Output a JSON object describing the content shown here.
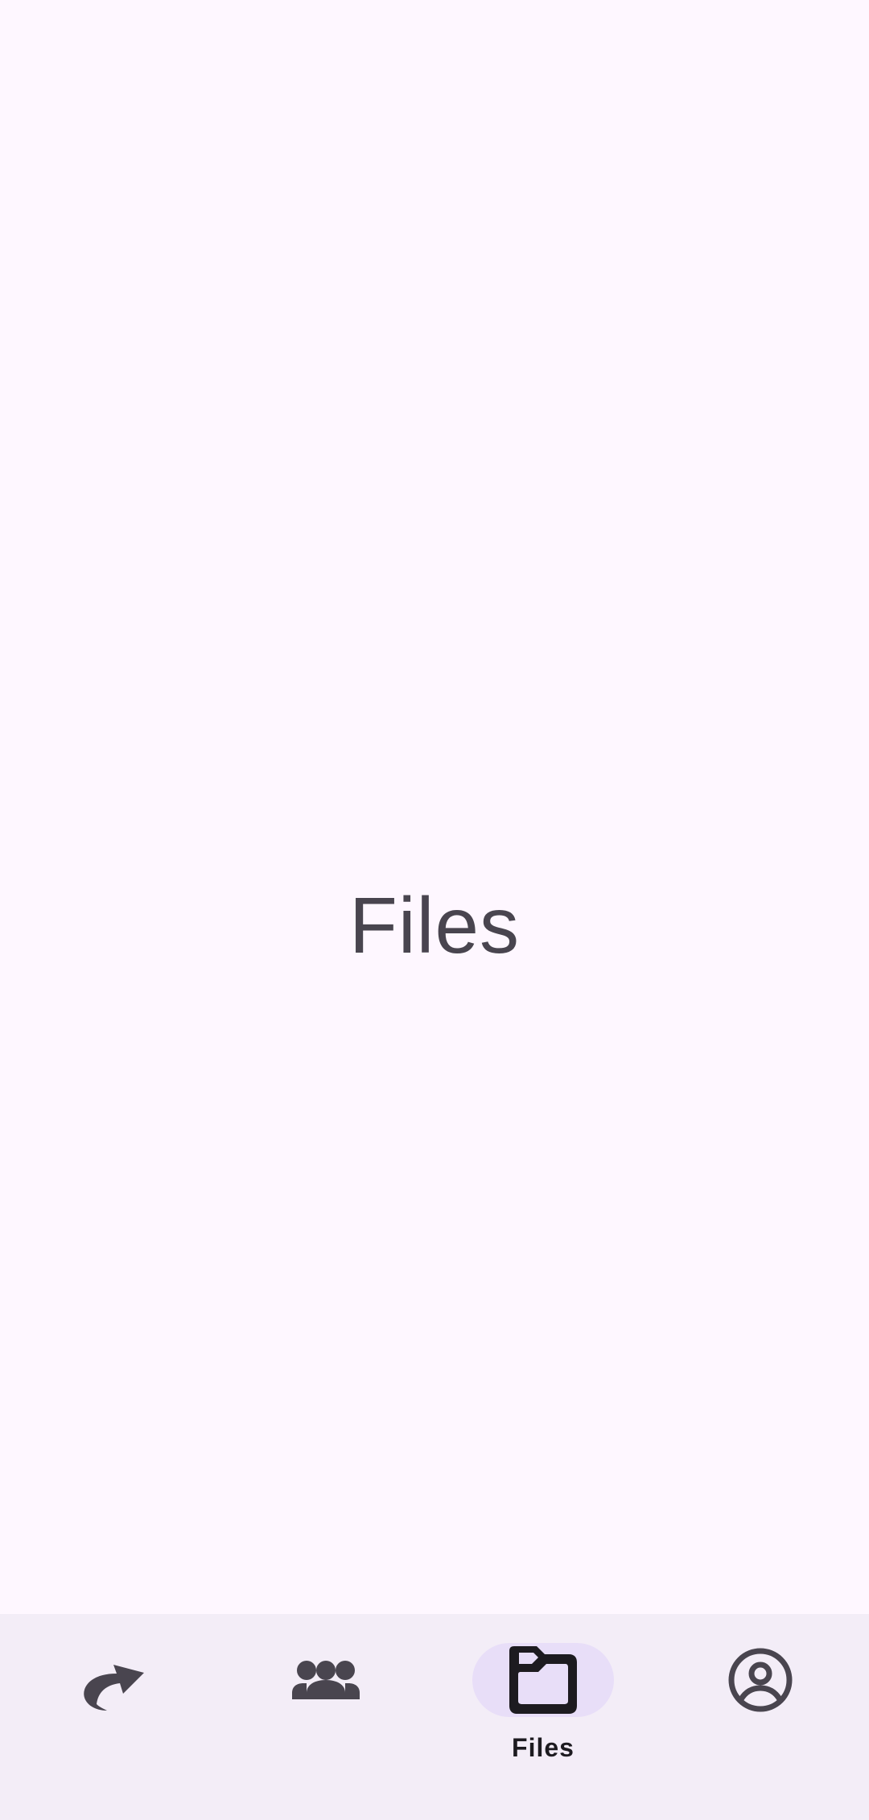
{
  "main": {
    "title": "Files"
  },
  "bottom_nav": {
    "selected_index": 2,
    "items": [
      {
        "icon": "share-arrow-icon",
        "label": ""
      },
      {
        "icon": "groups-icon",
        "label": ""
      },
      {
        "icon": "folder-icon",
        "label": "Files"
      },
      {
        "icon": "account-circle-icon",
        "label": ""
      }
    ]
  },
  "colors": {
    "background": "#FEF7FF",
    "nav_background": "#F3EDF7",
    "indicator": "#E8DEF8",
    "icon_inactive": "#49454F",
    "icon_active": "#1D1B20",
    "title_text": "#49454F"
  }
}
